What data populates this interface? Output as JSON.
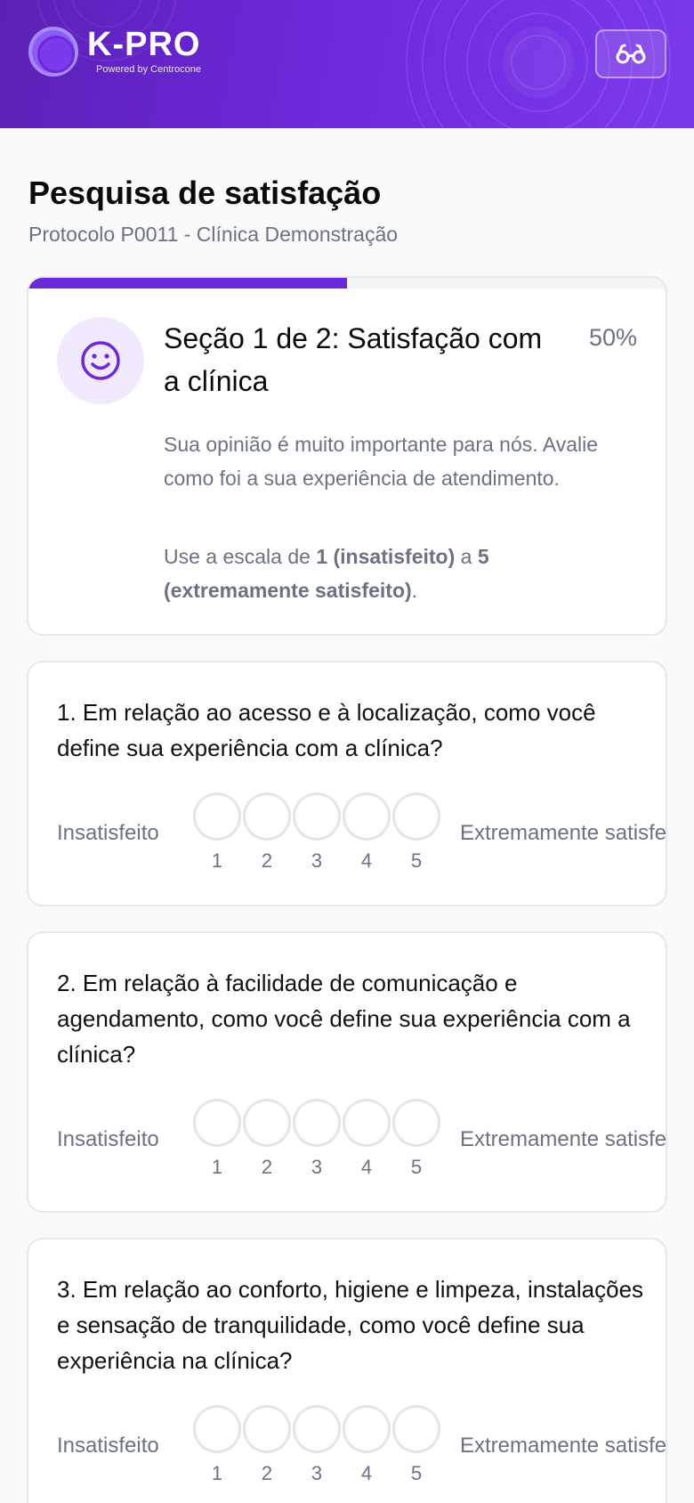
{
  "header": {
    "logo_title": "K-PRO",
    "logo_subtitle": "Powered by Centrocone",
    "accessibility_icon": "glasses-icon"
  },
  "page": {
    "title": "Pesquisa de satisfação",
    "subtitle": "Protocolo P0011 - Clínica Demonstração"
  },
  "section": {
    "title": "Seção 1 de 2: Satisfação com a clínica",
    "percent_label": "50%",
    "progress": 0.5,
    "icon": "smile-icon",
    "description": "Sua opinião é muito importante para nós. Avalie como foi a sua experiência de atendimento.",
    "scale_prefix": "Use a escala de ",
    "scale_min": "1 (insatisfeito)",
    "scale_mid": " a ",
    "scale_max": "5 (extremamente satisfeito)",
    "scale_suffix": "."
  },
  "questions": [
    {
      "text": "1. Em relação ao acesso e à localização, como você define sua experiência com a clínica?",
      "min_label": "Insatisfeito",
      "max_label": "Extremamente satisfeito",
      "options": [
        "1",
        "2",
        "3",
        "4",
        "5"
      ]
    },
    {
      "text": "2. Em relação à facilidade de comunicação e agendamento, como você define sua experiência com a clínica?",
      "min_label": "Insatisfeito",
      "max_label": "Extremamente satisfeito",
      "options": [
        "1",
        "2",
        "3",
        "4",
        "5"
      ]
    },
    {
      "text": "3. Em relação ao conforto, higiene e limpeza, instalações e sensação de tranquilidade, como você define sua experiência na clínica?",
      "min_label": "Insatisfeito",
      "max_label": "Extremamente satisfeito",
      "options": [
        "1",
        "2",
        "3",
        "4",
        "5"
      ]
    }
  ],
  "colors": {
    "brand": "#6d28d9",
    "muted_text": "#6b7280",
    "border": "#e5e7eb"
  }
}
